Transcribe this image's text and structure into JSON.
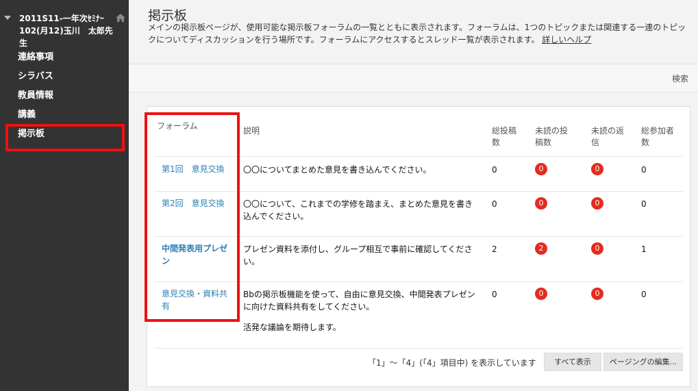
{
  "sidebar": {
    "course_title": "2011S11-一年次ｾﾐﾅｰ102(月12)玉川　太郎先生",
    "items": [
      {
        "label": "連絡事項"
      },
      {
        "label": "シラバス"
      },
      {
        "label": "教員情報"
      },
      {
        "label": "講義"
      },
      {
        "label": "掲示板"
      }
    ],
    "active_index": 4
  },
  "header": {
    "title": "掲示板",
    "description": "メインの掲示板ページが、使用可能な掲示板フォーラムの一覧とともに表示されます。フォーラムは、1つのトピックまたは関連する一連のトピックについてディスカッションを行う場所です。フォーラムにアクセスするとスレッド一覧が表示されます。",
    "help_link": "詳しいヘルプ"
  },
  "toolbar": {
    "search_label": "検索"
  },
  "table": {
    "headers": {
      "forum": "フォーラム",
      "description": "説明",
      "total_posts": "総投稿数",
      "unread_posts": "未読の投稿数",
      "unread_replies": "未読の返信",
      "participants": "総参加者数"
    },
    "rows": [
      {
        "forum": "第1回　意見交換",
        "description": "〇〇についてまとめた意見を書き込んでください。",
        "description2": "",
        "total": "0",
        "unread_posts": "0",
        "unread_replies": "0",
        "participants": "0"
      },
      {
        "forum": "第2回　意見交換",
        "description": "〇〇について、これまでの学修を踏まえ、まとめた意見を書き込んでください。",
        "description2": "",
        "total": "0",
        "unread_posts": "0",
        "unread_replies": "0",
        "participants": "0"
      },
      {
        "forum": "中間発表用プレゼン",
        "description": "プレゼン資料を添付し、グループ相互で事前に確認してください。",
        "description2": "",
        "total": "2",
        "unread_posts": "2",
        "unread_replies": "0",
        "participants": "1"
      },
      {
        "forum": "意見交換・資料共有",
        "description": "Bbの掲示板機能を使って、自由に意見交換、中間発表プレゼンに向けた資料共有をしてください。",
        "description2": "活発な議論を期待します。",
        "total": "0",
        "unread_posts": "0",
        "unread_replies": "0",
        "participants": "0"
      }
    ]
  },
  "footer": {
    "paging_text": "「1」～「4」(「4」項目中) を表示しています",
    "show_all_label": "すべて表示",
    "edit_paging_label": "ページングの編集..."
  },
  "colors": {
    "sidebar_bg": "#333333",
    "highlight": "#ee1111",
    "badge": "#e52b1f",
    "link": "#2b7fb4"
  }
}
